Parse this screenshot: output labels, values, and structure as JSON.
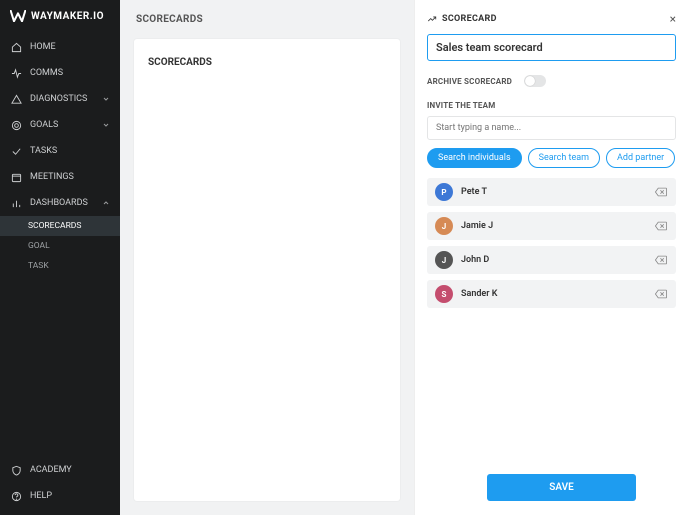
{
  "brand": "WAYMAKER.IO",
  "sidebar": {
    "items": [
      {
        "label": "HOME",
        "icon": "home"
      },
      {
        "label": "COMMS",
        "icon": "pulse"
      },
      {
        "label": "DIAGNOSTICS",
        "icon": "warning",
        "expandable": true,
        "expanded": false
      },
      {
        "label": "GOALS",
        "icon": "target",
        "expandable": true,
        "expanded": false
      },
      {
        "label": "TASKS",
        "icon": "check"
      },
      {
        "label": "MEETINGS",
        "icon": "calendar"
      },
      {
        "label": "DASHBOARDS",
        "icon": "bars",
        "expandable": true,
        "expanded": true,
        "children": [
          {
            "label": "SCORECARDS",
            "active": true
          },
          {
            "label": "GOAL"
          },
          {
            "label": "TASK"
          }
        ]
      }
    ],
    "footer": [
      {
        "label": "ACADEMY",
        "icon": "shield"
      },
      {
        "label": "HELP",
        "icon": "help"
      }
    ]
  },
  "page": {
    "header": "SCORECARDS",
    "card_title": "SCORECARDS"
  },
  "panel": {
    "title": "SCORECARD",
    "name_value": "Sales team scorecard",
    "archive_label": "ARCHIVE SCORECARD",
    "archive_on": false,
    "invite_label": "INVITE THE TEAM",
    "search_placeholder": "Start typing a name...",
    "pills": [
      {
        "label": "Search individuals",
        "active": true
      },
      {
        "label": "Search team",
        "active": false
      },
      {
        "label": "Add partner",
        "active": false
      }
    ],
    "members": [
      {
        "name": "Pete T",
        "initials": "P",
        "color": "#3d78d6"
      },
      {
        "name": "Jamie J",
        "initials": "J",
        "color": "#d68a55"
      },
      {
        "name": "John D",
        "initials": "J",
        "color": "#555555"
      },
      {
        "name": "Sander K",
        "initials": "S",
        "color": "#c44d6e"
      }
    ],
    "save_label": "SAVE"
  }
}
